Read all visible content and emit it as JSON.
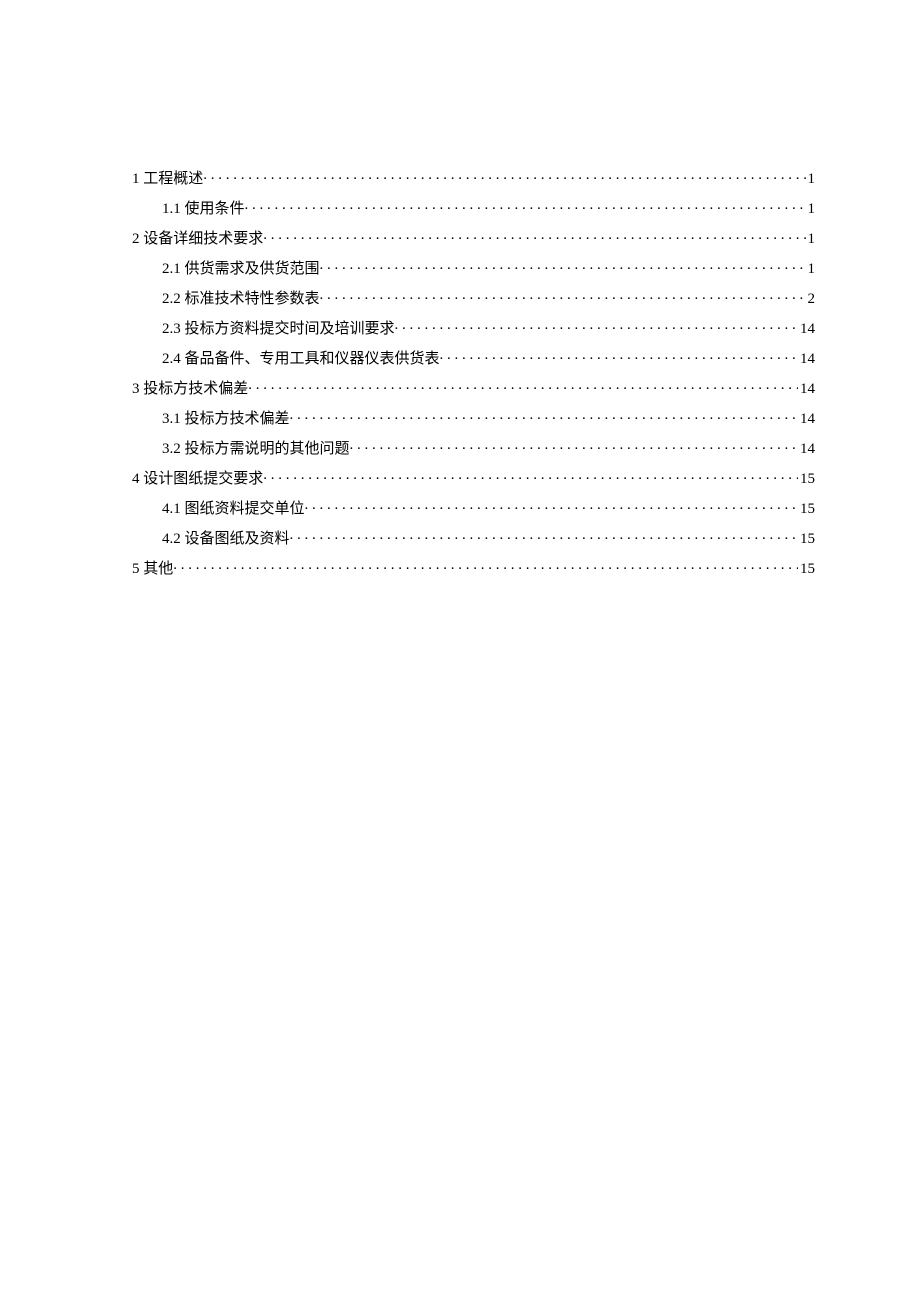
{
  "toc": [
    {
      "level": 0,
      "label": "1 工程概述",
      "page": "1"
    },
    {
      "level": 1,
      "label": "1.1 使用条件",
      "page": "1"
    },
    {
      "level": 0,
      "label": "2 设备详细技术要求",
      "page": "1"
    },
    {
      "level": 1,
      "label": "2.1  供货需求及供货范围",
      "page": "1"
    },
    {
      "level": 1,
      "label": "2.2  标准技术特性参数表",
      "page": "2"
    },
    {
      "level": 1,
      "label": "2.3  投标方资料提交时间及培训要求",
      "page": "14"
    },
    {
      "level": 1,
      "label": "2.4  备品备件、专用工具和仪器仪表供货表",
      "page": "14"
    },
    {
      "level": 0,
      "label": "3 投标方技术偏差",
      "page": "14"
    },
    {
      "level": 1,
      "label": "3.1  投标方技术偏差",
      "page": "14"
    },
    {
      "level": 1,
      "label": "3.2  投标方需说明的其他问题",
      "page": "14"
    },
    {
      "level": 0,
      "label": "4 设计图纸提交要求",
      "page": "15"
    },
    {
      "level": 1,
      "label": "4.1  图纸资料提交单位",
      "page": "15"
    },
    {
      "level": 1,
      "label": "4.2  设备图纸及资料",
      "page": "15"
    },
    {
      "level": 0,
      "label": "5 其他",
      "page": "15"
    }
  ]
}
